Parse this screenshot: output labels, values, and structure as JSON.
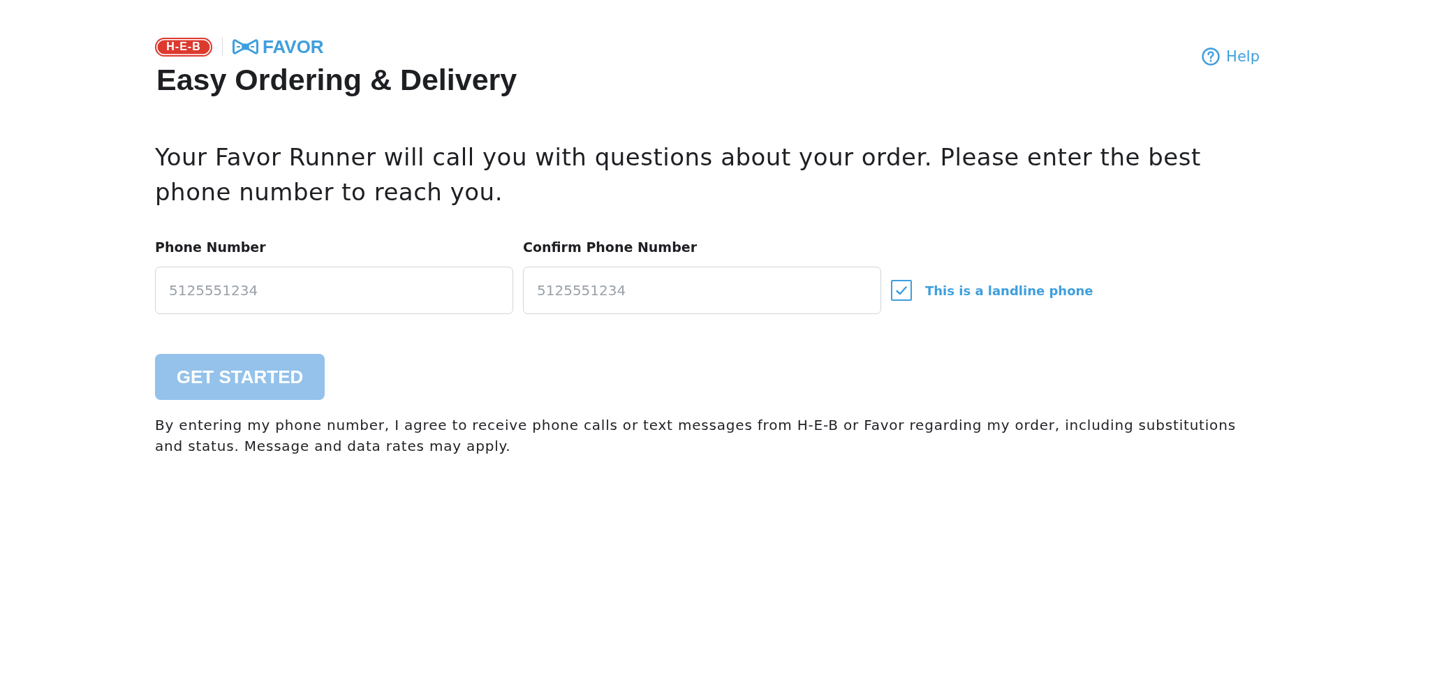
{
  "header": {
    "logo": {
      "brand": "H-E-B",
      "partner": "FAVOR"
    },
    "title": "Easy Ordering & Delivery",
    "help_link": "Help"
  },
  "intro": "Your Favor Runner will call you with questions about your order. Please enter the best phone number to reach you.",
  "fields": [
    {
      "label": "Phone Number",
      "placeholder": "5125551234"
    },
    {
      "label": "Confirm Phone Number",
      "placeholder": "5125551234"
    }
  ],
  "landline_checkbox": {
    "label": "This is a landline phone",
    "checked": true
  },
  "submit_button": {
    "label": "GET STARTED",
    "disabled": true
  },
  "disclaimer": "By entering my phone number, I agree to receive phone calls or text messages from H-E-B or Favor regarding my order, including substitutions and status. Message and data rates may apply."
}
